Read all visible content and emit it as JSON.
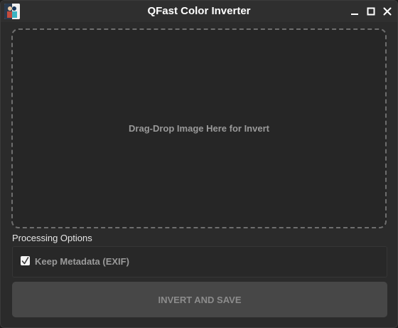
{
  "window": {
    "title": "QFast Color Inverter",
    "app_icon": "app-icon",
    "controls": [
      "minimize-icon",
      "maximize-icon",
      "close-icon"
    ]
  },
  "dropzone": {
    "text": "Drag-Drop Image Here for Invert"
  },
  "options": {
    "section_label": "Processing Options",
    "keep_metadata_label": "Keep Metadata (EXIF)",
    "keep_metadata_checked": true
  },
  "action": {
    "label": "INVERT AND SAVE",
    "enabled": false
  },
  "colors": {
    "window_bg": "#2b2b2b",
    "titlebar_bg": "#2f2f2f",
    "dropzone_border": "#6e6e6e",
    "button_bg": "#474747",
    "muted_text": "#9a9a9a"
  }
}
